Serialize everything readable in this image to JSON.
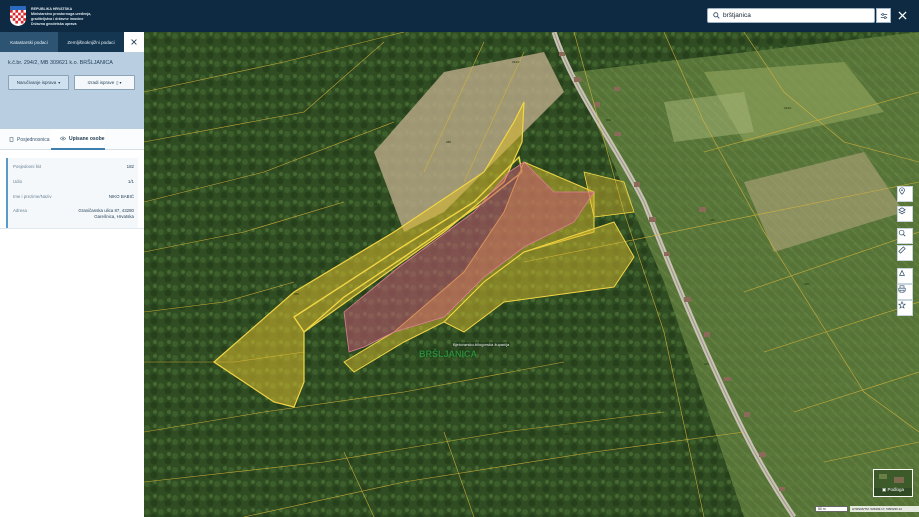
{
  "header": {
    "org_line1": "REPUBLIKA HRVATSKA",
    "org_line2": "Ministarstvo prostornoga uređenja,",
    "org_line3": "graditeljstva i državne imovine",
    "org_line4": "Državna geodetska uprava",
    "search_value": "brštjanica"
  },
  "panel": {
    "tabs": [
      "Katastarski podaci",
      "Zemljišnoknjižni podaci"
    ],
    "parcel_title": "k.č.br. 294/2, MB 309621 k.o. BRŠLJANICA",
    "btn_order": "Naručivanje isprava",
    "btn_free": "Izradi isprave",
    "subtabs": [
      "Posjednosnica",
      "Upisane osobe"
    ],
    "info": [
      {
        "key": "Posjedovni list",
        "value": "182"
      },
      {
        "key": "Udio",
        "value": "1/1"
      },
      {
        "key": "Ime i prezime/Naziv",
        "value": "NIKO BABIĆ"
      },
      {
        "key": "Adresa",
        "value": "Graničanska ulica 87, 43280 Garešnica, Hrvatska"
      }
    ]
  },
  "map": {
    "owner_label": "Bjelovarsko-bilogorska županija",
    "place_label": "BRŠLJANICA",
    "basemap_label": "Podloga",
    "scale_label": "50 m",
    "coords_text": "HTRS96/TM: 526909.17, 5050236.12",
    "parcel_numbers": [
      "294/2",
      "286",
      "302",
      "311",
      "319/1",
      "277",
      "265",
      "330",
      "341",
      "356"
    ],
    "colors": {
      "selected_parcel": "#d8b92e",
      "highlight_fill": "#c45a72",
      "parcel_lines": "#d7b43a"
    }
  },
  "icons": {
    "tools": [
      "pin-icon",
      "layers-icon",
      "zoom-icon",
      "ruler-icon",
      "cadastre-icon",
      "print-icon",
      "star-icon"
    ]
  }
}
